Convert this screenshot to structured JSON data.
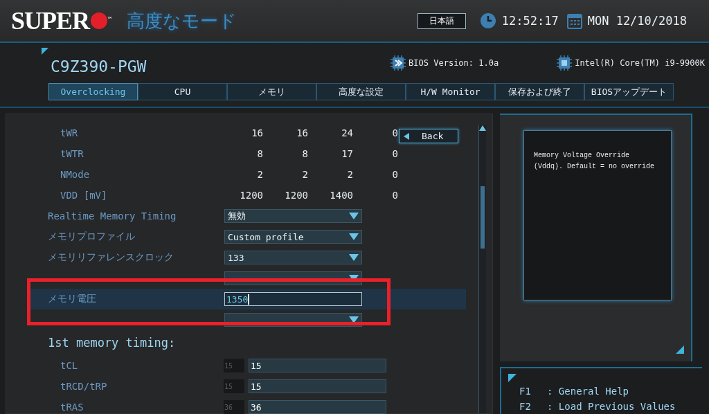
{
  "header": {
    "logo": "SUPER",
    "trademark": "™",
    "mode_title": "高度なモード",
    "language": "日本語",
    "time": "12:52:17",
    "date": "MON 12/10/2018"
  },
  "board": {
    "model": "C9Z390-PGW",
    "bios_version": "BIOS Version: 1.0a",
    "cpu": "Intel(R) Core(TM) i9-9900K"
  },
  "tabs": [
    {
      "label": "Overclocking",
      "selected": true
    },
    {
      "label": "CPU",
      "selected": false
    },
    {
      "label": "メモリ",
      "selected": false
    },
    {
      "label": "高度な設定",
      "selected": false
    },
    {
      "label": "H/W Monitor",
      "selected": false
    },
    {
      "label": "保存および終了",
      "selected": false
    },
    {
      "label": "BIOSアップデート",
      "selected": false
    }
  ],
  "back_button": "Back",
  "timing_table": [
    {
      "name": "tWR",
      "values": [
        "16",
        "16",
        "24",
        "0"
      ]
    },
    {
      "name": "tWTR",
      "values": [
        "8",
        "8",
        "17",
        "0"
      ]
    },
    {
      "name": "NMode",
      "values": [
        "2",
        "2",
        "2",
        "0"
      ]
    },
    {
      "name": "VDD [mV]",
      "values": [
        "1200",
        "1200",
        "1400",
        "0"
      ]
    }
  ],
  "settings": [
    {
      "kind": "dropdown",
      "label": "Realtime Memory Timing",
      "value": "無効",
      "selected": false
    },
    {
      "kind": "dropdown",
      "label": "メモリプロファイル",
      "value": "Custom profile",
      "selected": false
    },
    {
      "kind": "dropdown",
      "label": "メモリリファレンスクロック",
      "value": "133",
      "selected": false
    },
    {
      "kind": "dropdown",
      "selected": false
    },
    {
      "kind": "input",
      "label": "メモリ電圧",
      "value": "1350",
      "selected": true
    },
    {
      "kind": "dropdown",
      "selected": false
    }
  ],
  "annotation_box": true,
  "section_title": "1st memory timing:",
  "timings": [
    {
      "name": "tCL",
      "default": "15",
      "value": "15"
    },
    {
      "name": "tRCD/tRP",
      "default": "15",
      "value": "15"
    },
    {
      "name": "tRAS",
      "default": "36",
      "value": "36"
    }
  ],
  "help_text": "Memory Voltage Override (Vddq). Default = no override",
  "keys": [
    {
      "key": "F1",
      "action": ": General Help"
    },
    {
      "key": "F2",
      "action": ": Load Previous Values"
    }
  ]
}
